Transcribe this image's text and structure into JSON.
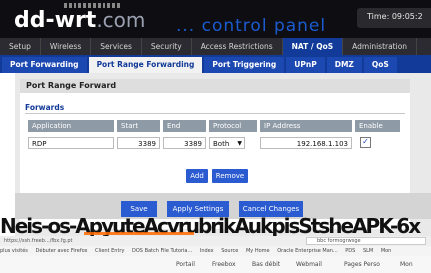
{
  "header": {
    "logo": "dd-wrt",
    "logo_suffix": ".com",
    "subtitle": "... control panel",
    "time_label": "Time: 09:05:2"
  },
  "main_tabs": [
    {
      "label": "Setup",
      "active": false
    },
    {
      "label": "Wireless",
      "active": false
    },
    {
      "label": "Services",
      "active": false
    },
    {
      "label": "Security",
      "active": false
    },
    {
      "label": "Access Restrictions",
      "active": false
    },
    {
      "label": "NAT / QoS",
      "active": true
    },
    {
      "label": "Administration",
      "active": false
    }
  ],
  "sub_tabs": [
    {
      "label": "Port Forwarding",
      "active": false
    },
    {
      "label": "Port Range Forwarding",
      "active": true
    },
    {
      "label": "Port Triggering",
      "active": false
    },
    {
      "label": "UPnP",
      "active": false
    },
    {
      "label": "DMZ",
      "active": false
    },
    {
      "label": "QoS",
      "active": false
    }
  ],
  "panel": {
    "title": "Port Range Forward",
    "legend": "Forwards",
    "columns": [
      "Application",
      "Start",
      "End",
      "Protocol",
      "IP Address",
      "Enable"
    ],
    "rows": [
      {
        "application": "RDP",
        "start": "3389",
        "end": "3389",
        "protocol": "Both",
        "ip": "192.168.1.103",
        "enable": true
      }
    ],
    "add_label": "Add",
    "remove_label": "Remove"
  },
  "footer_buttons": {
    "save": "Save",
    "apply": "Apply Settings",
    "cancel": "Cancel Changes"
  },
  "overlay_text": "Neis-os-ApyuteAcvrubrikAukpisStsheAPK-6x",
  "browser": {
    "url": "https://ssh.freeb.../fbx.fg.pt",
    "search": "bbc formogrwsge",
    "bookmarks": [
      "plus visités",
      "Débuter avec Firefox",
      "Client Entry",
      "DOS Batch File Tutoria...",
      "Index",
      "Source",
      "My Home",
      "Oracle Enterprise Man...",
      "PDS",
      "SLM",
      "Mon"
    ],
    "bookmarks2": [
      "Portail",
      "Freebox",
      "Bas débit",
      "Webmail",
      "Pages Perso",
      "Mon"
    ]
  },
  "colors": {
    "header_bg": "#0e0e12",
    "accent_blue": "#113a99",
    "button_blue": "#2a5bd1",
    "overlay_orange": "#ff6a00"
  }
}
